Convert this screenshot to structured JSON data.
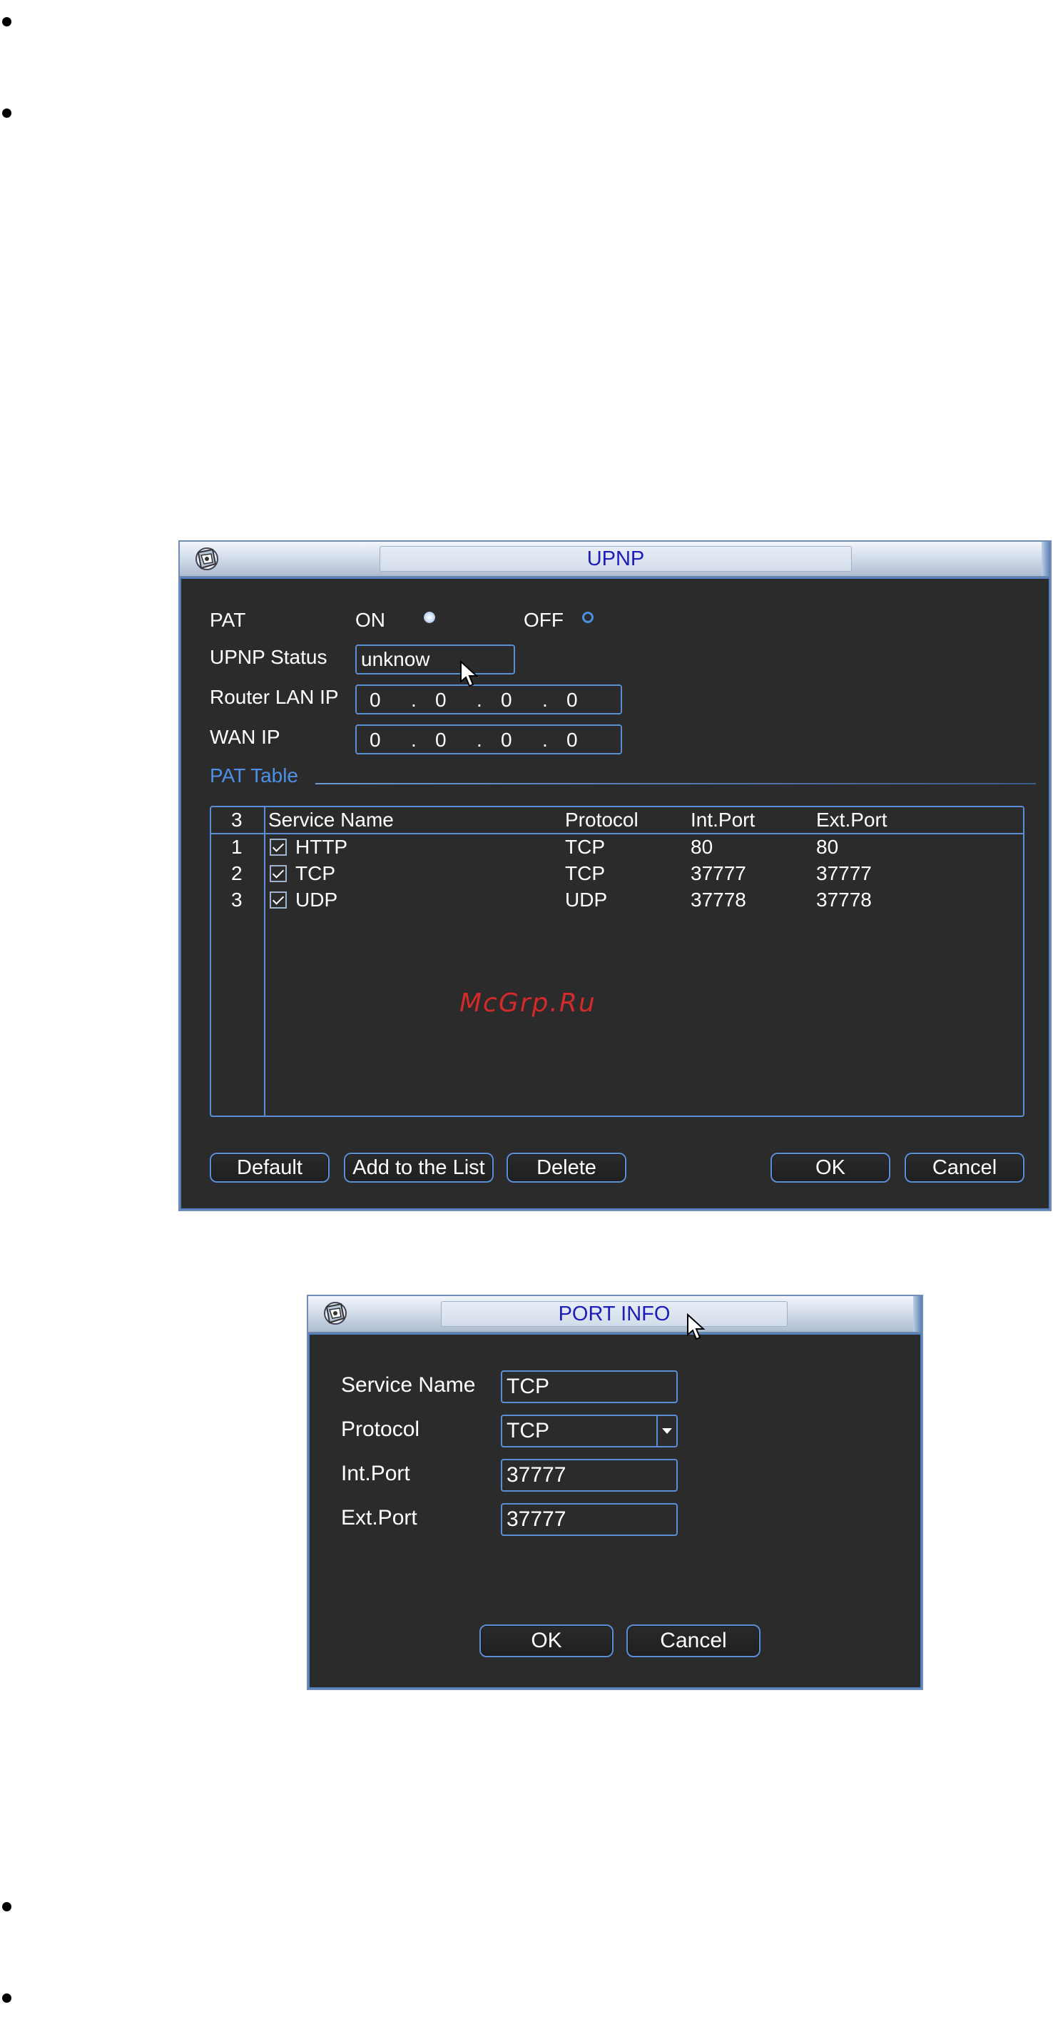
{
  "upnp": {
    "title": "UPNP",
    "pat_label": "PAT",
    "on_label": "ON",
    "off_label": "OFF",
    "status_label": "UPNP Status",
    "status_value": "unknow",
    "router_label": "Router LAN IP",
    "router_ip": [
      "0",
      "0",
      "0",
      "0"
    ],
    "wan_label": "WAN IP",
    "wan_ip": [
      "0",
      "0",
      "0",
      "0"
    ],
    "ip_dot": ".",
    "pat_table_label": "PAT Table",
    "table": {
      "count": "3",
      "headers": [
        "Service Name",
        "Protocol",
        "Int.Port",
        "Ext.Port"
      ],
      "rows": [
        {
          "index": "1",
          "name": "HTTP",
          "protocol": "TCP",
          "int_port": "80",
          "ext_port": "80"
        },
        {
          "index": "2",
          "name": "TCP",
          "protocol": "TCP",
          "int_port": "37777",
          "ext_port": "37777"
        },
        {
          "index": "3",
          "name": "UDP",
          "protocol": "UDP",
          "int_port": "37778",
          "ext_port": "37778"
        }
      ]
    },
    "buttons": {
      "default": "Default",
      "add": "Add to the List",
      "delete": "Delete",
      "ok": "OK",
      "cancel": "Cancel"
    }
  },
  "port_info": {
    "title": "PORT INFO",
    "service_label": "Service Name",
    "service_value": "TCP",
    "protocol_label": "Protocol",
    "protocol_value": "TCP",
    "int_label": "Int.Port",
    "int_value": "37777",
    "ext_label": "Ext.Port",
    "ext_value": "37777",
    "ok": "OK",
    "cancel": "Cancel"
  },
  "watermark": "McGrp.Ru",
  "colors": {
    "panel": "#303030",
    "accent_blue": "#5b8ed8",
    "title_text": "#1d1db8",
    "watermark": "#d42a2a"
  }
}
